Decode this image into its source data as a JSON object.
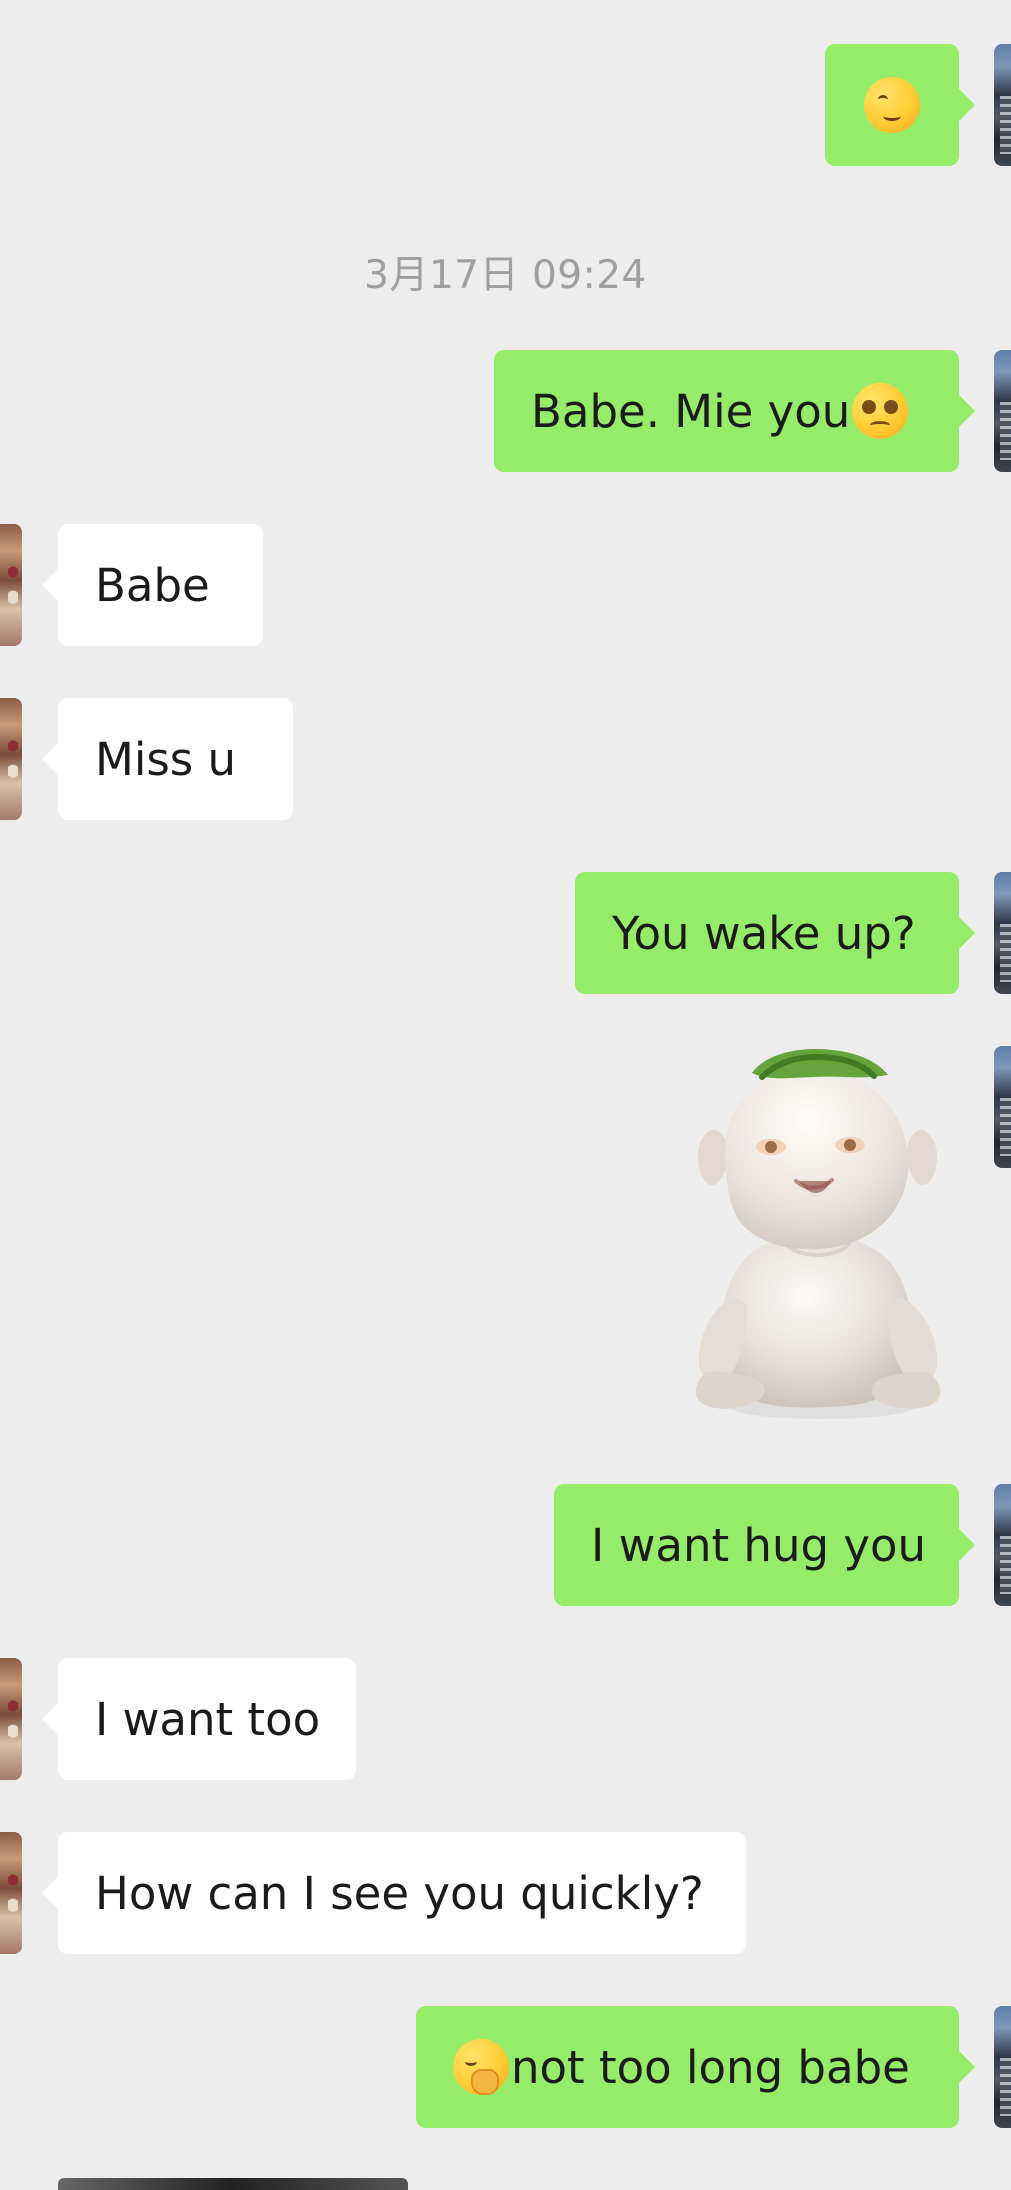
{
  "timestamp": "3月17日 09:24",
  "messages": [
    {
      "sender": "me",
      "type": "emoji",
      "emoji": "smiling-face-with-smiling-eyes"
    },
    {
      "sender": "me",
      "type": "text",
      "text": "Babe. Mie you",
      "emoji": "pleading-face"
    },
    {
      "sender": "them",
      "type": "text",
      "text": "Babe"
    },
    {
      "sender": "them",
      "type": "text",
      "text": "Miss u"
    },
    {
      "sender": "me",
      "type": "text",
      "text": "You wake up?"
    },
    {
      "sender": "me",
      "type": "sticker",
      "name": "white-creature-sticker"
    },
    {
      "sender": "me",
      "type": "text",
      "text": "I want hug you"
    },
    {
      "sender": "them",
      "type": "text",
      "text": "I want too"
    },
    {
      "sender": "them",
      "type": "text",
      "text": "How can I see you quickly?"
    },
    {
      "sender": "me",
      "type": "text",
      "text": "not too long babe",
      "emoji": "face-with-hand-over-mouth"
    }
  ],
  "colors": {
    "background": "#ededed",
    "outgoing_bubble": "#95ec69",
    "incoming_bubble": "#ffffff",
    "timestamp": "#9f9f9f",
    "text": "#1b1b1b"
  }
}
